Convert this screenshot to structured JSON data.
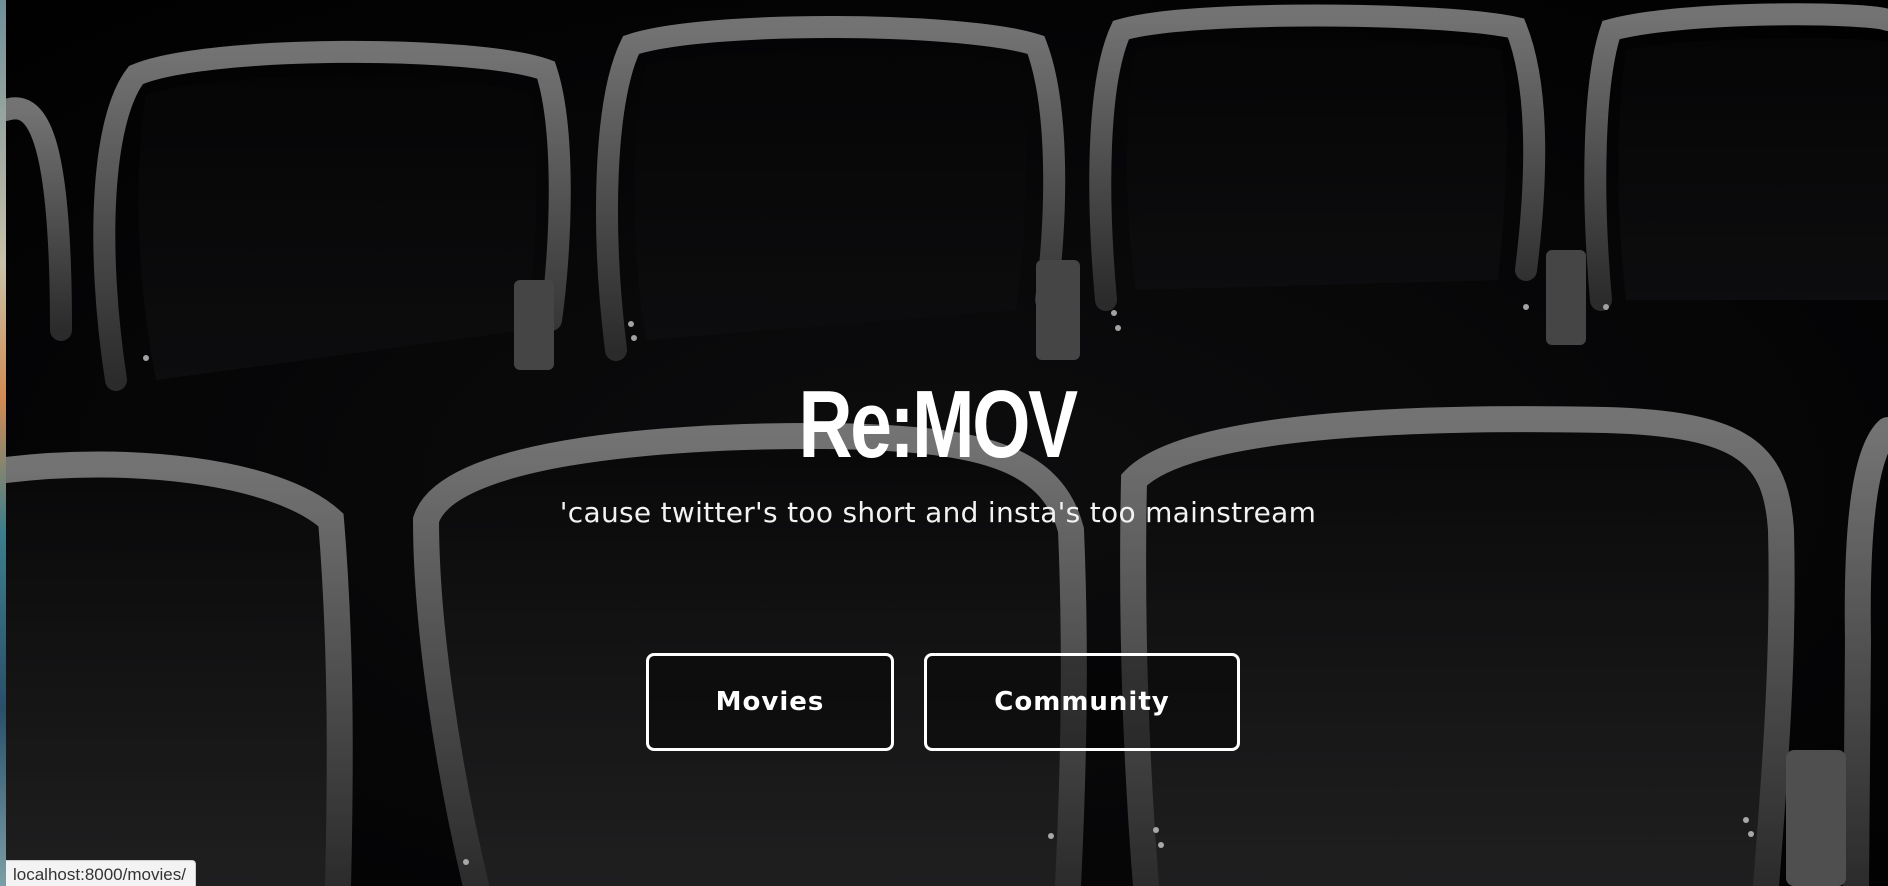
{
  "hero": {
    "title": "Re:MOV",
    "tagline": "'cause twitter's too short and insta's too mainstream"
  },
  "buttons": {
    "movies_label": "Movies",
    "community_label": "Community"
  },
  "status_bar": {
    "url": "localhost:8000/movies/"
  },
  "colors": {
    "background": "#050506",
    "text": "#ffffff",
    "button_border": "#ffffff"
  }
}
